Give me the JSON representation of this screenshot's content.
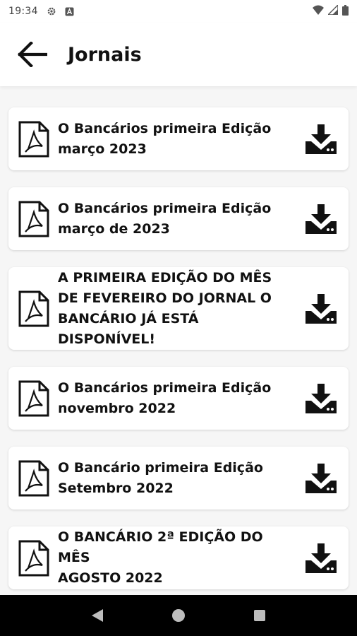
{
  "status_bar": {
    "time": "19:34",
    "icons": [
      "gear-icon",
      "a-badge-icon",
      "wifi-icon",
      "signal-icon",
      "battery-icon"
    ]
  },
  "app_bar": {
    "title": "Jornais",
    "back_icon": "arrow-left-icon"
  },
  "journals": [
    {
      "title_line1": "O Bancários primeira Edição",
      "title_line2": "março 2023",
      "title_line3": ""
    },
    {
      "title_line1": "O Bancários primeira Edição",
      "title_line2": "março de 2023",
      "title_line3": ""
    },
    {
      "title_line1": "A PRIMEIRA EDIÇÃO DO MÊS",
      "title_line2": "DE FEVEREIRO DO JORNAL O",
      "title_line3": "BANCÁRIO JÁ ESTÁ DISPONÍVEL!"
    },
    {
      "title_line1": "O Bancários primeira Edição",
      "title_line2": "novembro 2022",
      "title_line3": ""
    },
    {
      "title_line1": "O Bancário primeira Edição",
      "title_line2": "Setembro 2022",
      "title_line3": ""
    },
    {
      "title_line1": "O BANCÁRIO 2ª EDIÇÃO DO MÊS",
      "title_line2": "AGOSTO 2022",
      "title_line3": ""
    }
  ],
  "item_icons": {
    "leading": "pdf-file-icon",
    "trailing": "download-icon"
  },
  "nav_bar": {
    "buttons": [
      "back-triangle-icon",
      "home-circle-icon",
      "recents-square-icon"
    ]
  },
  "colors": {
    "background": "#f6f6f6",
    "surface": "#ffffff",
    "text": "#111111",
    "nav": "#000000"
  }
}
